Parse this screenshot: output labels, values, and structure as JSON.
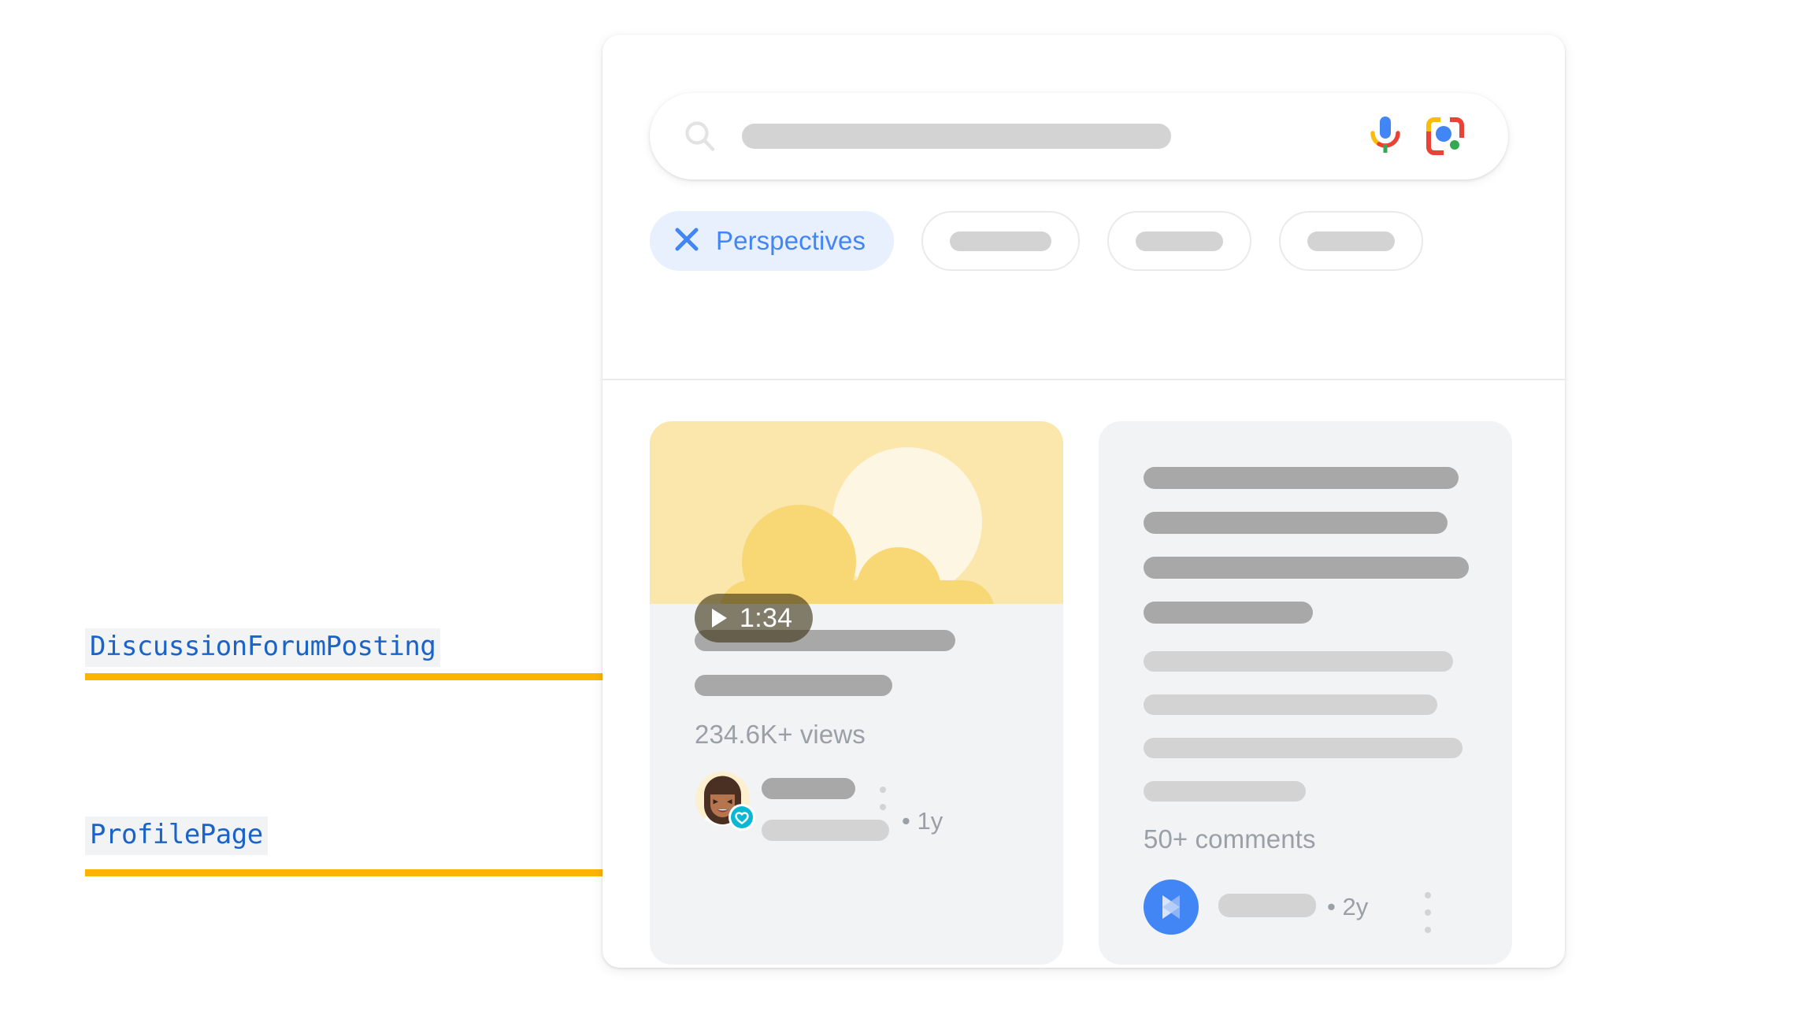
{
  "annotations": [
    {
      "label": "DiscussionForumPosting",
      "color": "#1a63c8"
    },
    {
      "label": "ProfilePage",
      "color": "#1a63c8"
    }
  ],
  "annotation_line_color": "#fbb400",
  "search": {
    "search_icon": "search-icon",
    "query_value": "",
    "placeholder": "",
    "mic_icon": "google-microphone-icon",
    "lens_icon": "google-lens-icon"
  },
  "chips": [
    {
      "label": "Perspectives",
      "icon": "close-x-icon",
      "active": true
    },
    {
      "label": "",
      "active": false
    },
    {
      "label": "",
      "active": false
    },
    {
      "label": "",
      "active": false
    }
  ],
  "chip_active_bg": "#e8f0fe",
  "chip_active_fg": "#4285f4",
  "results": [
    {
      "type": "video-forum-post",
      "thumbnail": "sun-and-clouds-illustration",
      "duration": "1:34",
      "play_icon": "play-icon",
      "stats": "234.6K+ views",
      "author_avatar": "person-avatar",
      "author_badge": "heart-verified-badge",
      "age": "• 1y",
      "overflow_icon": "more-vert-icon"
    },
    {
      "type": "discussion-post",
      "stats": "50+ comments",
      "author_avatar": "blue-play-avatar",
      "age": "• 2y",
      "overflow_icon": "more-vert-icon"
    }
  ]
}
